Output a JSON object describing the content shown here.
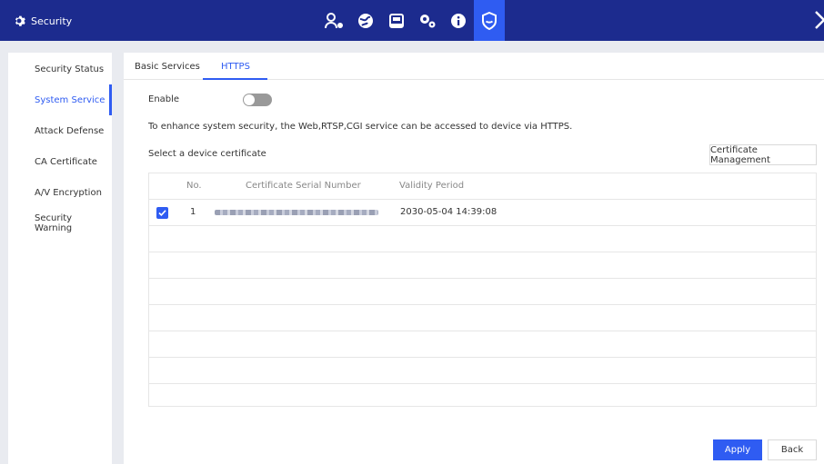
{
  "app": {
    "title": "Security"
  },
  "top_nav": {
    "icons": [
      "account-icon",
      "network-icon",
      "storage-icon",
      "system-settings-icon",
      "info-icon",
      "security-shield-icon"
    ],
    "active": "security-shield-icon"
  },
  "sidebar": {
    "items": [
      {
        "label": "Security Status",
        "active": false
      },
      {
        "label": "System Service",
        "active": true
      },
      {
        "label": "Attack Defense",
        "active": false
      },
      {
        "label": "CA Certificate",
        "active": false
      },
      {
        "label": "A/V Encryption",
        "active": false
      },
      {
        "label": "Security Warning",
        "active": false
      }
    ]
  },
  "tabs": [
    {
      "label": "Basic Services",
      "active": false
    },
    {
      "label": "HTTPS",
      "active": true
    }
  ],
  "https": {
    "enable_label": "Enable",
    "enable_on": false,
    "description": "To enhance system security, the Web,RTSP,CGI service can be accessed to device via HTTPS.",
    "select_cert_label": "Select a device certificate",
    "cert_mgmt_button": "Certificate Management",
    "table": {
      "headers": {
        "no": "No.",
        "serial": "Certificate Serial Number",
        "validity": "Validity Period"
      },
      "rows": [
        {
          "checked": true,
          "no": "1",
          "validity": "2030-05-04 14:39:08"
        }
      ]
    }
  },
  "footer": {
    "apply": "Apply",
    "back": "Back"
  },
  "colors": {
    "topbar": "#1c2b8e",
    "accent": "#2f5cf2",
    "background": "#e9ebf0"
  }
}
